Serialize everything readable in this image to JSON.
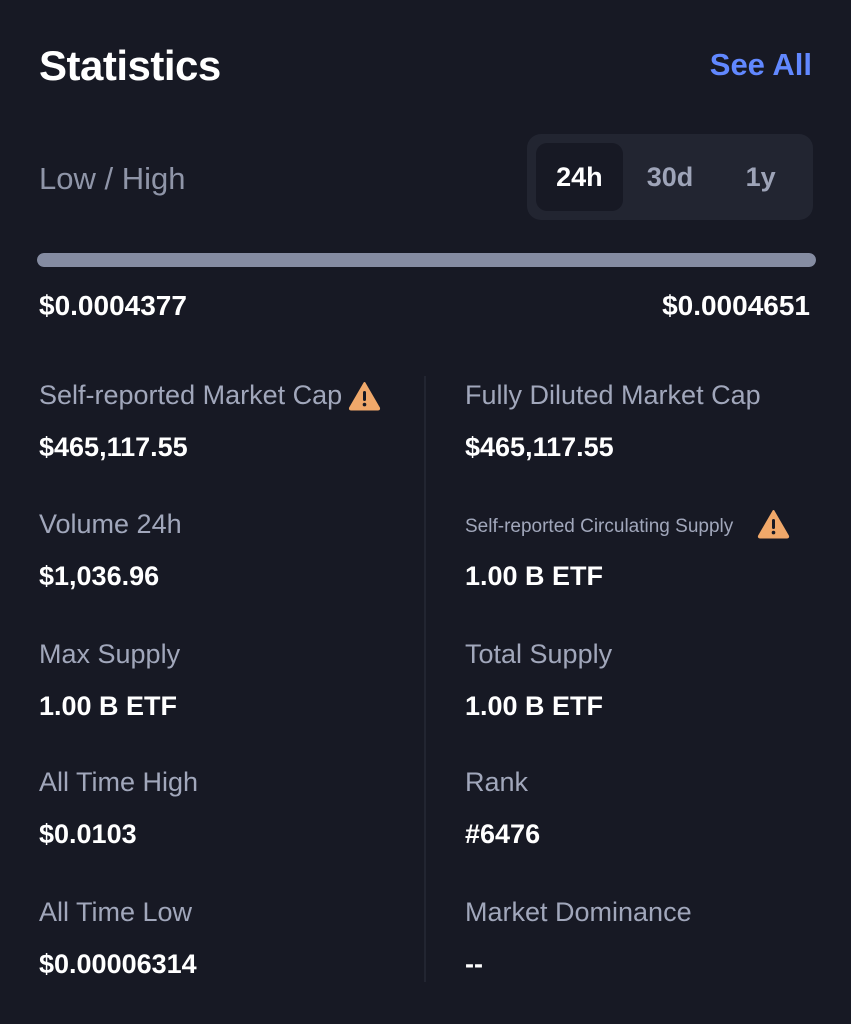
{
  "header": {
    "title": "Statistics",
    "see_all": "See All"
  },
  "range": {
    "label": "Low / High",
    "tabs": [
      "24h",
      "30d",
      "1y"
    ],
    "active_tab": "24h",
    "low": "$0.0004377",
    "high": "$0.0004651",
    "position_fraction": 1.0
  },
  "stats": {
    "self_market_cap": {
      "label": "Self-reported Market Cap",
      "value": "$465,117.55",
      "icon": "warning-icon"
    },
    "fully_diluted": {
      "label": "Fully Diluted Market Cap",
      "value": "$465,117.55"
    },
    "volume_24h": {
      "label": "Volume 24h",
      "value": "$1,036.96"
    },
    "self_circulating": {
      "label": "Self-reported Circulating Supply",
      "value": "1.00 B ETF",
      "icon": "warning-icon"
    },
    "max_supply": {
      "label": "Max Supply",
      "value": "1.00 B ETF"
    },
    "total_supply": {
      "label": "Total Supply",
      "value": "1.00 B ETF"
    },
    "ath": {
      "label": "All Time High",
      "value": "$0.0103"
    },
    "rank": {
      "label": "Rank",
      "value": "#6476"
    },
    "atl": {
      "label": "All Time Low",
      "value": "$0.00006314"
    },
    "dominance": {
      "label": "Market Dominance",
      "value": "--"
    }
  },
  "colors": {
    "background": "#171924",
    "accent": "#6188ff",
    "warning": "#f0a86a"
  }
}
